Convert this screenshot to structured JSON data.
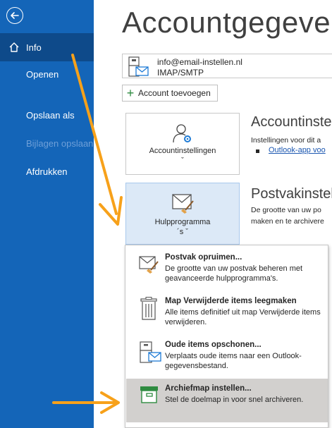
{
  "nav": {
    "items": [
      {
        "label": "Info"
      },
      {
        "label": "Openen"
      },
      {
        "label": "Opslaan als"
      },
      {
        "label": "Bijlagen opslaan"
      },
      {
        "label": "Afdrukken"
      }
    ]
  },
  "page": {
    "title": "Accountgegevens"
  },
  "account": {
    "email": "info@email-instellen.nl",
    "type": "IMAP/SMTP"
  },
  "add_account_label": "Account toevoegen",
  "sections": {
    "settings": {
      "button_label": "Accountinstellingen",
      "dropdown_mark": "ˇ",
      "title": "Accountinstell",
      "text": "Instellingen voor dit a",
      "link": "Outlook-app voo"
    },
    "tools": {
      "button_line1": "Hulpprogramma",
      "button_line2": "´s ˇ",
      "title": "Postvakinstellin",
      "text1": "De grootte van uw po",
      "text2": "maken en te archivere"
    }
  },
  "menu": {
    "items": [
      {
        "title": "Postvak opruimen...",
        "desc": "De grootte van uw postvak beheren met geavanceerde hulpprogramma's."
      },
      {
        "title": "Map Verwijderde items leegmaken",
        "desc": "Alle items definitief uit map Verwijderde items verwijderen."
      },
      {
        "title": "Oude items opschonen...",
        "desc": "Verplaats oude items naar een Outlook-gegevensbestand."
      },
      {
        "title": "Archiefmap instellen...",
        "desc": "Stel de doelmap in voor snel archiveren."
      }
    ]
  },
  "colors": {
    "sidebar": "#1465b8",
    "sidebar_selected": "#0e4a8a",
    "arrow": "#f7a11a",
    "highlight": "#d2d0ce"
  },
  "icons": {
    "back": "back-arrow-icon",
    "home": "home-icon",
    "account": "account-settings-icon",
    "tools": "mailbox-cleanup-icon",
    "trash": "trash-icon",
    "archive": "archive-icon"
  }
}
